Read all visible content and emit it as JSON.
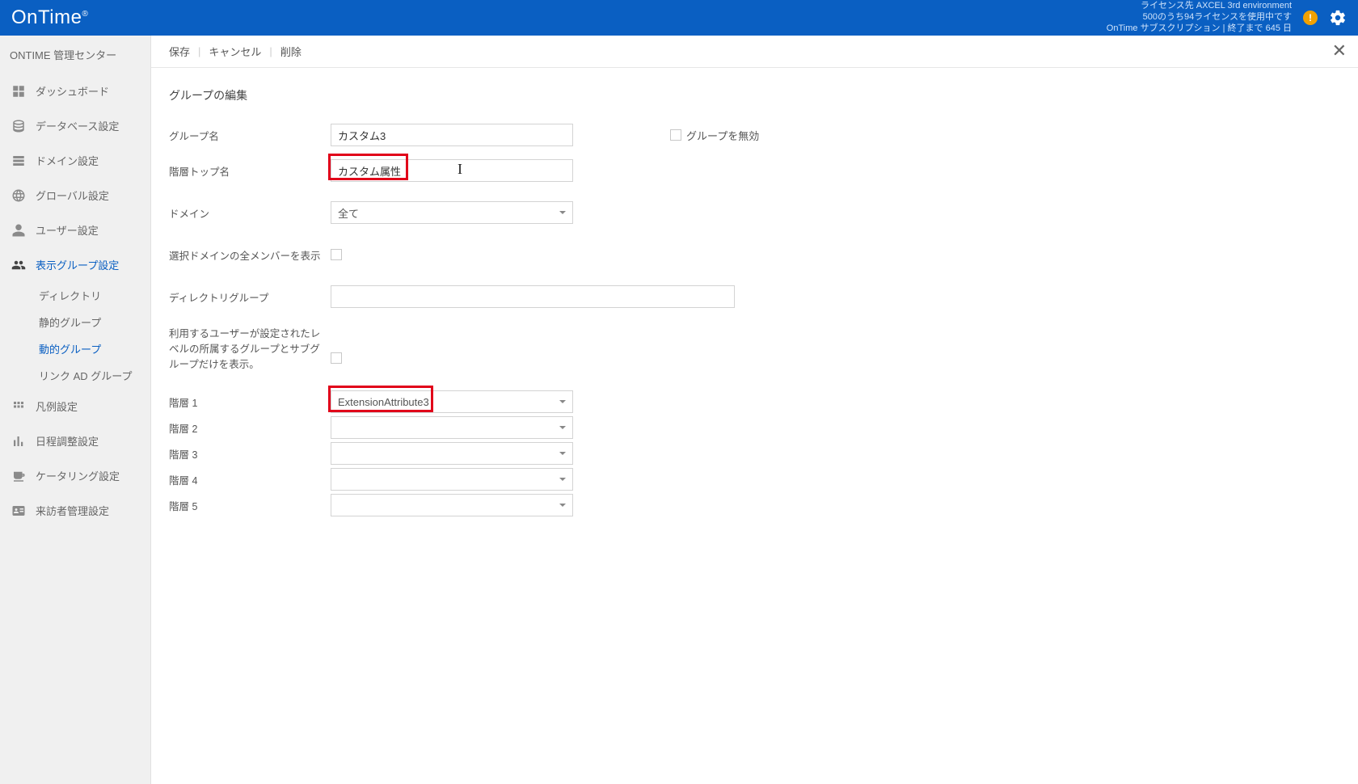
{
  "header": {
    "logo": "OnTime",
    "license_line1": "ライセンス先 AXCEL 3rd environment",
    "license_line2": "500のうち94ライセンスを使用中です",
    "license_line3": "OnTime サブスクリプション | 終了まで 645 日"
  },
  "sidebar": {
    "title": "ONTIME 管理センター",
    "items": [
      {
        "label": "ダッシュボード"
      },
      {
        "label": "データベース設定"
      },
      {
        "label": "ドメイン設定"
      },
      {
        "label": "グローバル設定"
      },
      {
        "label": "ユーザー設定"
      },
      {
        "label": "表示グループ設定",
        "active": true
      },
      {
        "label": "凡例設定"
      },
      {
        "label": "日程調整設定"
      },
      {
        "label": "ケータリング設定"
      },
      {
        "label": "来訪者管理設定"
      }
    ],
    "subitems": [
      {
        "label": "ディレクトリ"
      },
      {
        "label": "静的グループ"
      },
      {
        "label": "動的グループ",
        "active": true
      },
      {
        "label": "リンク AD グループ"
      }
    ]
  },
  "toolbar": {
    "save": "保存",
    "cancel": "キャンセル",
    "delete": "削除"
  },
  "form": {
    "section_title": "グループの編集",
    "labels": {
      "group_name": "グループ名",
      "disable_group": "グループを無効",
      "top_name": "階層トップ名",
      "domain": "ドメイン",
      "show_all_members": "選択ドメインの全メンバーを表示",
      "directory_group": "ディレクトリグループ",
      "level_note": "利用するユーザーが設定されたレベルの所属するグループとサブグループだけを表示。",
      "tier1": "階層 1",
      "tier2": "階層 2",
      "tier3": "階層 3",
      "tier4": "階層 4",
      "tier5": "階層 5"
    },
    "values": {
      "group_name": "カスタム3",
      "top_name": "カスタム属性",
      "domain_selected": "全て",
      "tier1_selected": "ExtensionAttribute3",
      "tier2_selected": "",
      "tier3_selected": "",
      "tier4_selected": "",
      "tier5_selected": ""
    }
  }
}
